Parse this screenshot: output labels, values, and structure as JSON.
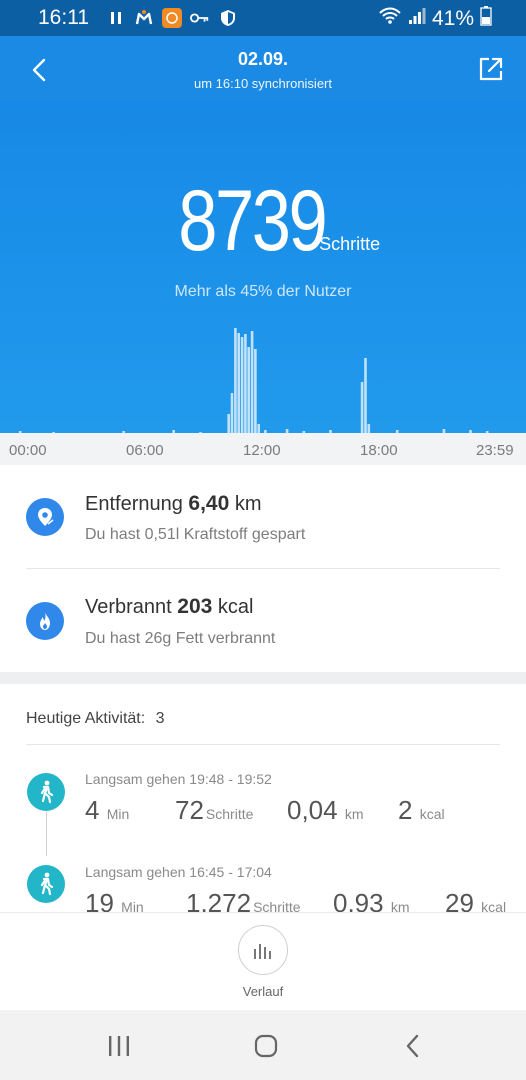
{
  "status_bar": {
    "time": "16:11",
    "battery": "41%",
    "icons_left": [
      "pause-icon",
      "mi-fit-icon",
      "app-orange-icon",
      "key-icon",
      "shield-icon"
    ],
    "icons_right": [
      "wifi-icon",
      "signal-icon",
      "battery-icon"
    ]
  },
  "header": {
    "date": "02.09.",
    "sync_status": "um 16:10 synchronisiert",
    "back_icon": "chevron-left-icon",
    "share_icon": "share-icon"
  },
  "hero": {
    "steps": "8739",
    "steps_unit": "Schritte",
    "comparison": "Mehr als 45% der Nutzer"
  },
  "chart_data": {
    "type": "bar",
    "x_start": "00:00",
    "x_end": "23:59",
    "tick_labels": [
      "00:00",
      "06:00",
      "12:00",
      "18:00",
      "23:59"
    ],
    "bars": [
      {
        "t": "00:10",
        "v": 2
      },
      {
        "t": "01:50",
        "v": 1
      },
      {
        "t": "05:20",
        "v": 2
      },
      {
        "t": "07:50",
        "v": 3
      },
      {
        "t": "09:10",
        "v": 1
      },
      {
        "t": "10:35",
        "v": 19
      },
      {
        "t": "10:45",
        "v": 40
      },
      {
        "t": "10:55",
        "v": 105
      },
      {
        "t": "11:05",
        "v": 100
      },
      {
        "t": "11:15",
        "v": 96
      },
      {
        "t": "11:25",
        "v": 99
      },
      {
        "t": "11:35",
        "v": 86
      },
      {
        "t": "11:45",
        "v": 102
      },
      {
        "t": "11:55",
        "v": 84
      },
      {
        "t": "12:05",
        "v": 9
      },
      {
        "t": "12:25",
        "v": 3
      },
      {
        "t": "13:30",
        "v": 4
      },
      {
        "t": "14:20",
        "v": 2
      },
      {
        "t": "15:40",
        "v": 3
      },
      {
        "t": "17:15",
        "v": 51
      },
      {
        "t": "17:25",
        "v": 75
      },
      {
        "t": "17:35",
        "v": 9
      },
      {
        "t": "19:00",
        "v": 3
      },
      {
        "t": "21:20",
        "v": 4
      },
      {
        "t": "22:40",
        "v": 3
      },
      {
        "t": "23:30",
        "v": 2
      }
    ],
    "colors": {
      "background": "#1c8fe8",
      "bar": "#ffffff"
    }
  },
  "summary": {
    "distance": {
      "label": "Entfernung",
      "value": "6,40",
      "unit": "km",
      "sub": "Du hast 0,51l Kraftstoff gespart",
      "icon": "location-pin-icon"
    },
    "calories": {
      "label": "Verbrannt",
      "value": "203",
      "unit": "kcal",
      "sub": "Du hast 26g Fett verbrannt",
      "icon": "flame-icon"
    }
  },
  "activities": {
    "heading_label": "Heutige Aktivität:",
    "count": "3",
    "items": [
      {
        "title": "Langsam gehen 19:48 - 19:52",
        "duration": "4",
        "duration_unit": "Min",
        "steps": "72",
        "steps_unit": "Schritte",
        "distance": "0,04",
        "distance_unit": "km",
        "kcal": "2",
        "kcal_unit": "kcal",
        "icon": "walking-person-icon"
      },
      {
        "title": "Langsam gehen 16:45 - 17:04",
        "duration": "19",
        "duration_unit": "Min",
        "steps": "1.272",
        "steps_unit": "Schritte",
        "distance": "0,93",
        "distance_unit": "km",
        "kcal": "29",
        "kcal_unit": "kcal",
        "icon": "walking-person-icon"
      }
    ]
  },
  "bottom": {
    "history_label": "Verlauf",
    "history_icon": "bar-chart-icon"
  },
  "nav": {
    "recents_icon": "recent-apps-icon",
    "home_icon": "home-icon",
    "back_icon": "back-icon"
  },
  "colors": {
    "header_blue": "#1b8ae5",
    "status_blue": "#0d5fa3",
    "icon_blue": "#2f88ea",
    "activity_teal": "#22b6c8"
  }
}
